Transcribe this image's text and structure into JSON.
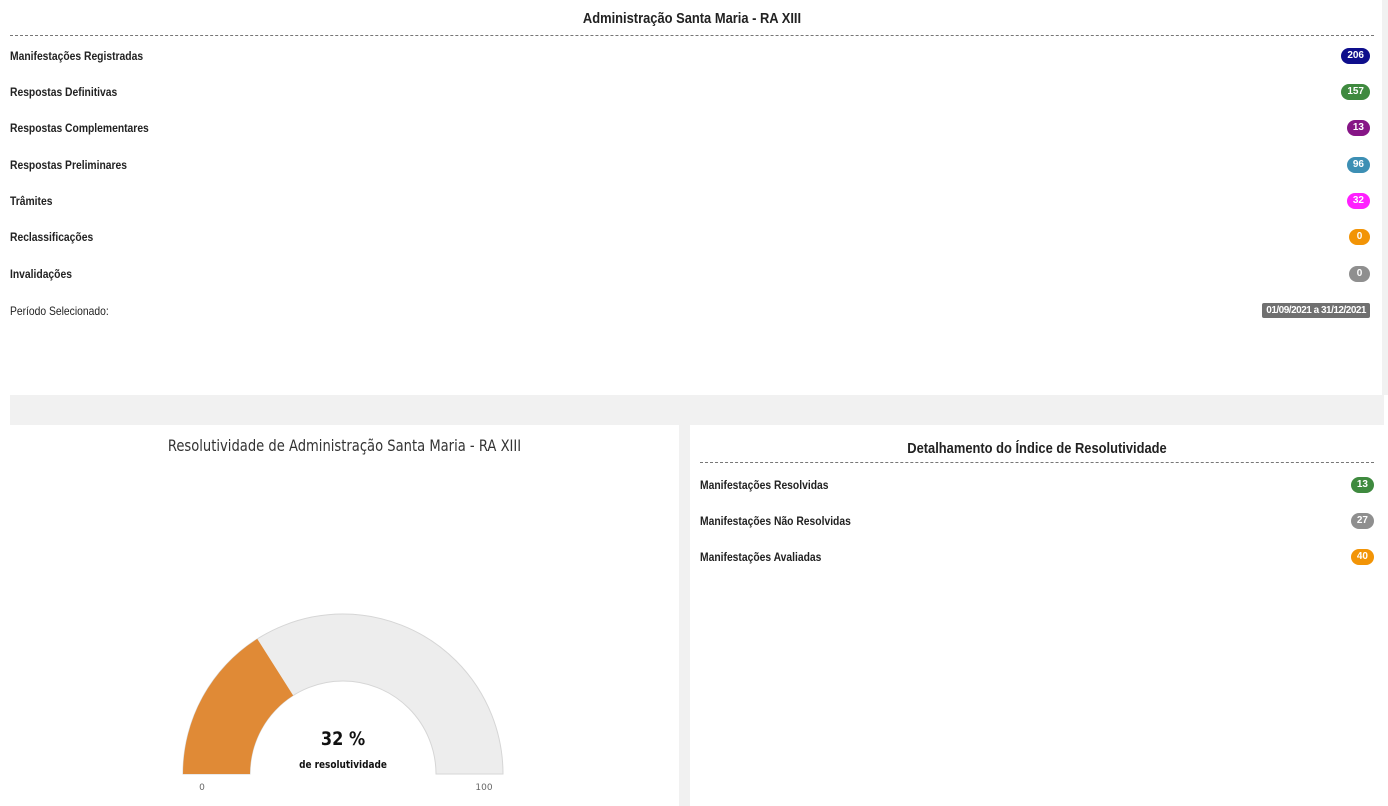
{
  "header": {
    "title": "Administração Santa Maria - RA XIII"
  },
  "stats": [
    {
      "label": "Manifestações Registradas",
      "value": "206",
      "color": "#0e0e8c"
    },
    {
      "label": "Respostas Definitivas",
      "value": "157",
      "color": "#3f8a3f"
    },
    {
      "label": "Respostas Complementares",
      "value": "13",
      "color": "#861586"
    },
    {
      "label": "Respostas Preliminares",
      "value": "96",
      "color": "#3c8fb4"
    },
    {
      "label": "Trâmites",
      "value": "32",
      "color": "#ff1fff"
    },
    {
      "label": "Reclassificações",
      "value": "0",
      "color": "#f29406"
    },
    {
      "label": "Invalidações",
      "value": "0",
      "color": "#8f8f8f"
    }
  ],
  "period": {
    "label": "Período Selecionado:",
    "value": "01/09/2021 a 31/12/2021"
  },
  "gauge": {
    "title": "Resolutividade de Administração Santa Maria - RA XIII",
    "value": 32,
    "value_text": "32 %",
    "caption": "de resolutividade",
    "min_label": "0",
    "max_label": "100",
    "fill_color": "#e08a36",
    "track_color": "#ededed"
  },
  "detail": {
    "title": "Detalhamento do Índice de Resolutividade",
    "items": [
      {
        "label": "Manifestações Resolvidas",
        "value": "13",
        "color": "#3f8a3f"
      },
      {
        "label": "Manifestações Não Resolvidas",
        "value": "27",
        "color": "#8f8f8f"
      },
      {
        "label": "Manifestações Avaliadas",
        "value": "40",
        "color": "#f29406"
      }
    ]
  }
}
